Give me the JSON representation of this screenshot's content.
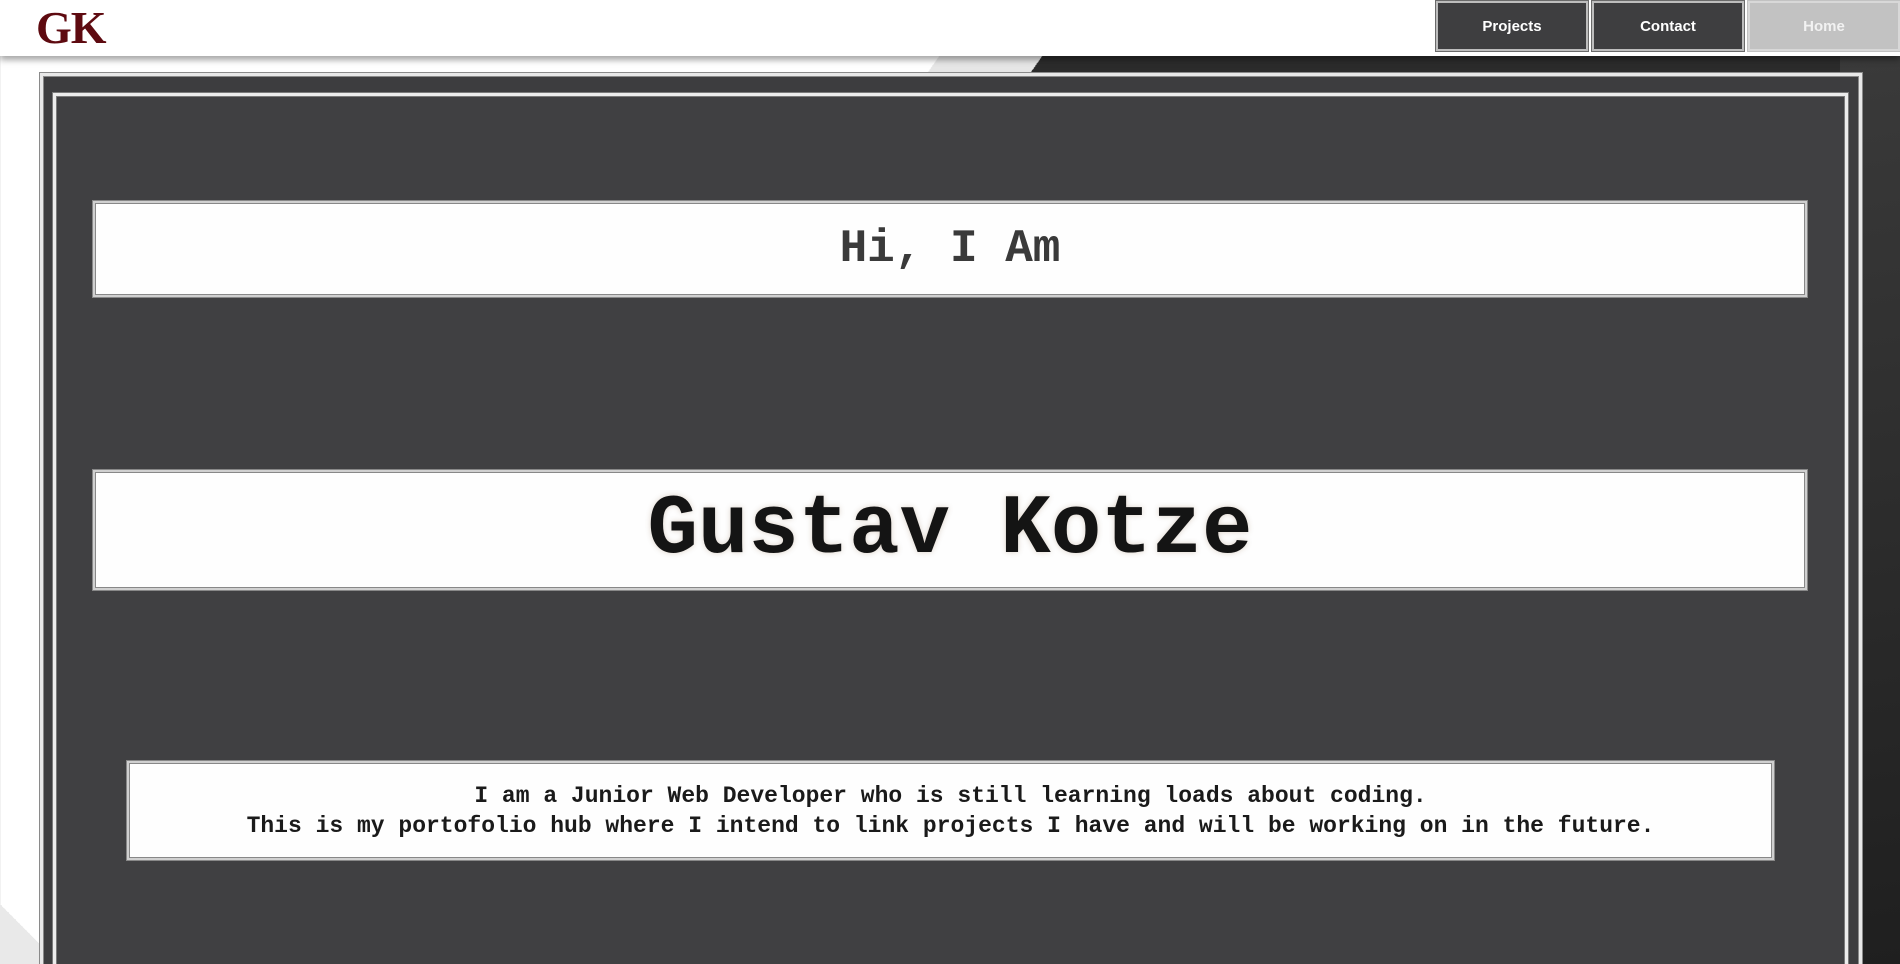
{
  "header": {
    "logo": "GK",
    "nav": [
      {
        "label": "Projects",
        "active": false
      },
      {
        "label": "Contact",
        "active": false
      },
      {
        "label": "Home",
        "active": true
      }
    ]
  },
  "main": {
    "greeting": "Hi, I Am",
    "name": "Gustav Kotze",
    "intro_lines": [
      "I am a Junior Web Developer who is still learning loads about coding.",
      "This is my portofolio hub where I intend to link projects I have and will be working on in the future."
    ]
  },
  "colors": {
    "logo": "#5e0a10",
    "panel": "#404042",
    "nav_button": "#3e3e40",
    "nav_active": "#c2c2c2"
  }
}
